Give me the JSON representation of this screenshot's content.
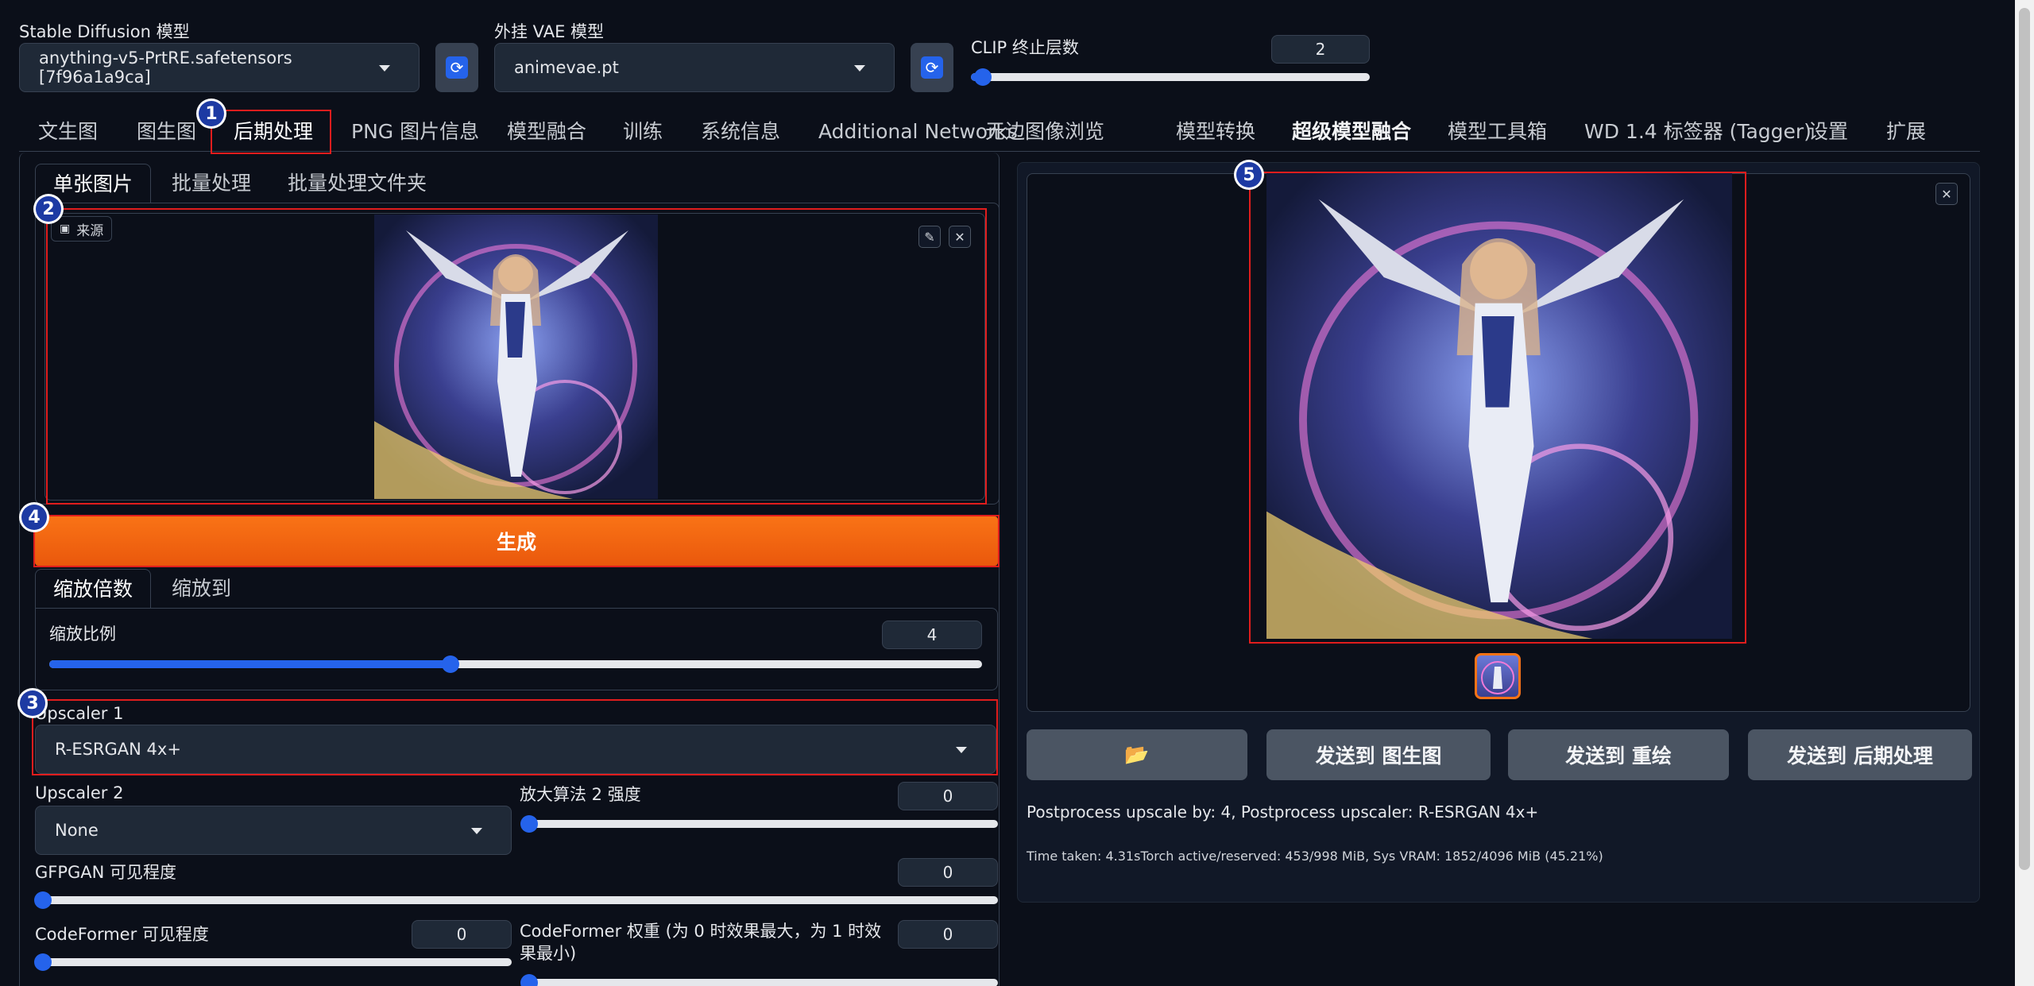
{
  "top": {
    "sd_model_label": "Stable Diffusion 模型",
    "sd_model_value": "anything-v5-PrtRE.safetensors [7f96a1a9ca]",
    "vae_label": "外挂 VAE 模型",
    "vae_value": "animevae.pt",
    "clip_label": "CLIP 终止层数",
    "clip_value": "2",
    "clip_slider_fraction": 0.03
  },
  "tabs": [
    {
      "label": "文生图"
    },
    {
      "label": "图生图"
    },
    {
      "label": "后期处理"
    },
    {
      "label": "PNG 图片信息"
    },
    {
      "label": "模型融合"
    },
    {
      "label": "训练"
    },
    {
      "label": "系统信息"
    },
    {
      "label": "Additional Networks"
    },
    {
      "label": "无边图像浏览"
    },
    {
      "label": "模型转换"
    },
    {
      "label": "超级模型融合"
    },
    {
      "label": "模型工具箱"
    },
    {
      "label": "WD 1.4 标签器 (Tagger)"
    },
    {
      "label": "设置"
    },
    {
      "label": "扩展"
    }
  ],
  "left": {
    "subtabs": [
      "单张图片",
      "批量处理",
      "批量处理文件夹"
    ],
    "source_label": "来源",
    "generate_label": "生成",
    "scale_tabs": [
      "缩放倍数",
      "缩放到"
    ],
    "scale_label": "缩放比例",
    "scale_value": "4",
    "scale_slider_fraction": 0.43,
    "upscaler1_label": "Upscaler 1",
    "upscaler1_value": "R-ESRGAN 4x+",
    "upscaler2_label": "Upscaler 2",
    "upscaler2_value": "None",
    "upscaler2_strength_label": "放大算法 2 强度",
    "upscaler2_strength_value": "0",
    "gfpgan_label": "GFPGAN 可见程度",
    "gfpgan_value": "0",
    "codeformer_vis_label": "CodeFormer 可见程度",
    "codeformer_vis_value": "0",
    "codeformer_weight_label": "CodeFormer 权重 (为 0 时效果最大，为 1 时效果最小)",
    "codeformer_weight_value": "0"
  },
  "right": {
    "folder_icon": "📂",
    "send_img2img": "发送到 图生图",
    "send_inpaint": "发送到 重绘",
    "send_extras": "发送到 后期处理",
    "info_line": "Postprocess upscale by: 4, Postprocess upscaler: R-ESRGAN 4x+",
    "time_line": "Time taken: 4.31sTorch active/reserved: 453/998 MiB, Sys VRAM: 1852/4096 MiB (45.21%)"
  },
  "badges": [
    "1",
    "2",
    "3",
    "4",
    "5"
  ],
  "colors": {
    "background": "#0b0f19",
    "accent": "#2563eb",
    "generate": "#f97316",
    "highlight": "#e11d1d"
  }
}
